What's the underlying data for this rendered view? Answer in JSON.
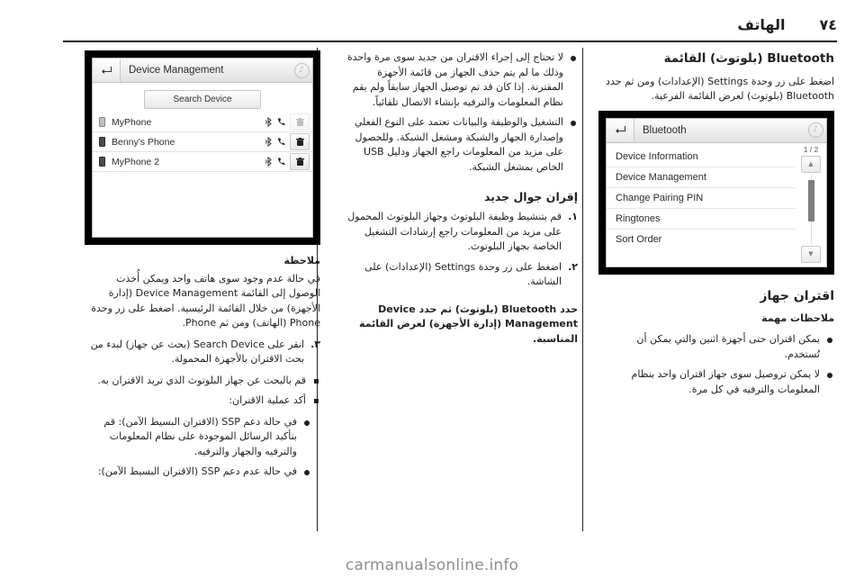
{
  "header": {
    "page_number": "٧٤",
    "chapter_title": "الهاتف"
  },
  "watermark": "carmanualsonline.info",
  "right_column": {
    "heading": "Bluetooth (بلوتوث) القائمة",
    "intro": "اضغط على زر وحدة Settings (الإعدادات) ومن ثم حدد Bluetooth (بلوتوث) لعرض القائمة الفرعية.",
    "screenshot": {
      "title": "Bluetooth",
      "back_icon": "back-arrow-icon",
      "note_icon": "music-note-icon",
      "page_indicator": "1 / 2",
      "up_arrow": "▲",
      "down_arrow": "▼",
      "items": [
        "Device Information",
        "Device Management",
        "Change Pairing PIN",
        "Ringtones",
        "Sort Order"
      ]
    },
    "pairing_heading": "اقتران جهاز",
    "notes_label": "ملاحظات مهمة",
    "notes": [
      "يمكن اقتران حتى أجهزة اثنين والتي يمكن أن تُستخدم.",
      "لا يمكن تروصيل سوى جهاز اقتران واحد بنظام المعلومات والترفيه في كل مرة."
    ]
  },
  "middle_column": {
    "notes": [
      "لا تحتاج إلى إجراء الاقتران من جديد سوى مرة واحدة وذلك ما لم يتم حذف الجهاز من قائمة الأجهزة المقترنة. إذا كان قد تم توصيل الجهاز سابقاً ولم يقم نظام المعلومات والترفيه بإنشاء الاتصال تلقائياً.",
      "التشغيل والوظيفة والبيانات تعتمد على النوع الفعلي وإصدارة الجهاز والشبكة ومشغل الشبكة. وللحصول على مزيد من المعلومات راجع الجهاز ودليل USB الخاص بمشغل الشبكة."
    ],
    "pair_heading": "إقران جوال جديد",
    "steps": [
      "قم بتنشيط وظيفة البلوتوث وجهاز البلوتوث المحمول على مزيد من المعلومات راجع إرشادات التشغيل الخاصة بجهاز البلوتوث.",
      "اضغط على زر وحدة Settings (الإعدادات) على الشاشة."
    ],
    "closing": "حدد Bluetooth (بلوتوث) ثم حدد Device Management (إدارة الأجهزة) لعرض القائمة المناسبة."
  },
  "left_column": {
    "screenshot": {
      "title": "Device Management",
      "back_icon": "back-arrow-icon",
      "note_icon": "music-note-icon",
      "search_button": "Search Device",
      "devices": [
        {
          "name": "MyPhone",
          "phone_icon": "mobile-icon",
          "bt_icon": "bluetooth-audio-icon",
          "call_icon": "handset-icon",
          "delete_icon": "trash-icon",
          "delete_enabled": false
        },
        {
          "name": "Benny's Phone",
          "phone_icon": "mobile-icon",
          "bt_icon": "bluetooth-audio-icon",
          "call_icon": "handset-icon",
          "delete_icon": "trash-icon",
          "delete_enabled": true
        },
        {
          "name": "MyPhone 2",
          "phone_icon": "mobile-icon",
          "bt_icon": "bluetooth-audio-icon",
          "call_icon": "handset-icon",
          "delete_icon": "trash-icon",
          "delete_enabled": true
        }
      ]
    },
    "note_label": "ملاحظة",
    "note_text": "في حالة عدم وجود سوى هاتف واحد ويمكن أُخذت الوصول إلى القائمة Device Management (إدارة الأجهزة) من خلال القائمة الرئيسية. اضغط على زر وحدة Phone (الهاتف) ومن ثم Phone.",
    "steps": [
      "انقر على Search Device (بحث عن جهاز) لبدء من بحث الاقتران بالأجهزة المحمولة."
    ],
    "sub_items": [
      "قم بالبحث عن جهاز البلوتوث الذي تريد الاقتران به.",
      "أكد عملية الاقتران:"
    ],
    "bullets": [
      "في حالة دعم SSP (الاقتران البسيط الآمن): قم بتأكيد الرسائل الموجودة على نظام المعلومات والترفيه والجهاز والترفيه.",
      "في حالة عدم دعم SSP (الاقتران البسيط الآمن):"
    ]
  }
}
